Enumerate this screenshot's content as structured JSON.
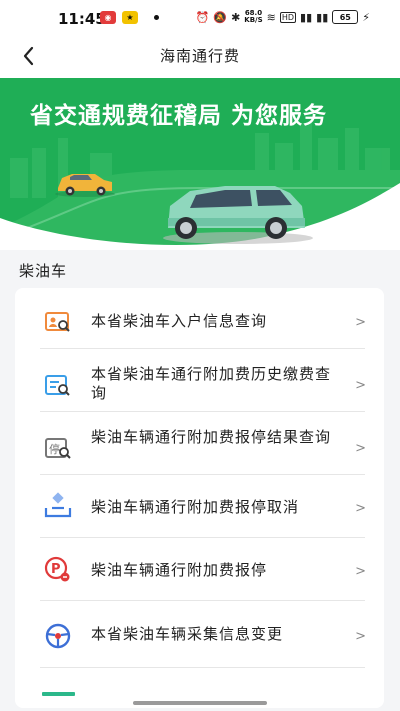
{
  "status_bar": {
    "time": "11:45",
    "speed": "68.0",
    "speed_unit": "KB/S",
    "battery": "65"
  },
  "nav": {
    "title": "海南通行费"
  },
  "banner": {
    "title": "省交通规费征稽局 为您服务"
  },
  "section": {
    "title": "柴油车"
  },
  "menu": [
    {
      "label": "本省柴油车入户信息查询",
      "icon": "id-card-search-icon",
      "color": "#f08a3c"
    },
    {
      "label": "本省柴油车通行附加费历史缴费查询",
      "icon": "receipt-search-icon",
      "color": "#3a9ee8"
    },
    {
      "label": "柴油车辆通行附加费报停结果查询",
      "icon": "suspend-result-search-icon",
      "color": "#777777"
    },
    {
      "label": "柴油车辆通行附加费报停取消",
      "icon": "cancel-suspension-icon",
      "color": "#3d7be0"
    },
    {
      "label": "柴油车辆通行附加费报停",
      "icon": "parking-suspension-icon",
      "color": "#e03a3a"
    },
    {
      "label": "本省柴油车辆采集信息变更",
      "icon": "steering-wheel-icon",
      "color": "#3d6fd6"
    }
  ],
  "chevron": ">"
}
